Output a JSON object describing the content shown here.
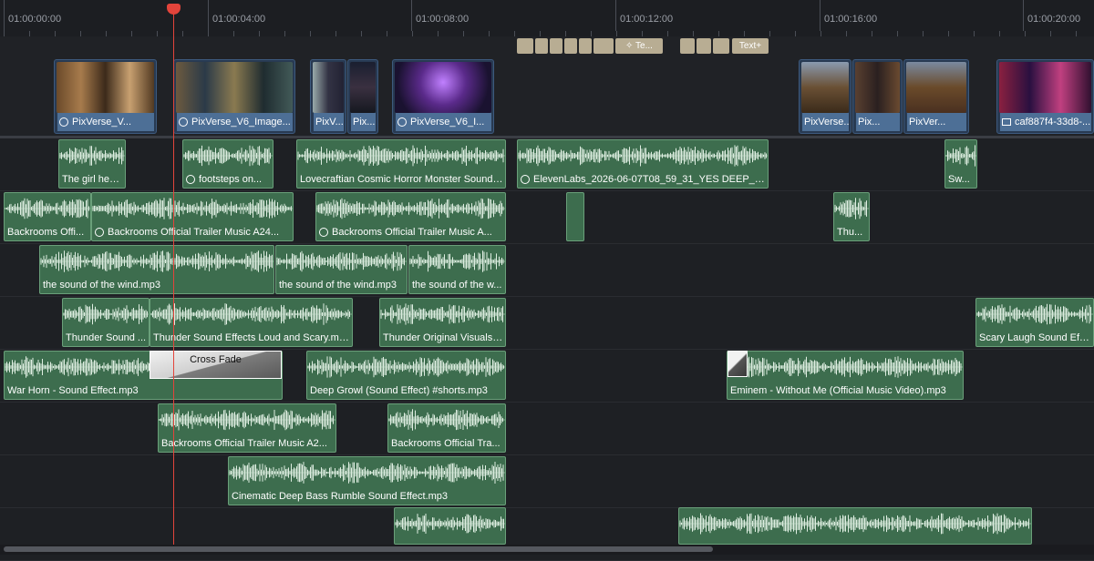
{
  "timeline": {
    "ruler": {
      "timecodes": [
        "01:00:00:00",
        "01:00:04:00",
        "01:00:08:00",
        "01:00:12:00",
        "01:00:16:00",
        "01:00:20:00"
      ]
    },
    "title_track": {
      "text_clip_1": "Te...",
      "text_clip_2": "Text+"
    },
    "video_track": {
      "clips": [
        {
          "label": "PixVerse_V...",
          "speed_icon": true
        },
        {
          "label": "PixVerse_V6_Image...",
          "speed_icon": true
        },
        {
          "label": "PixV...",
          "speed_icon": false
        },
        {
          "label": "Pix...",
          "speed_icon": false
        },
        {
          "label": "PixVerse_V6_I...",
          "speed_icon": true
        },
        {
          "label": "PixVerse...",
          "speed_icon": false
        },
        {
          "label": "Pix...",
          "speed_icon": false
        },
        {
          "label": "PixVer...",
          "speed_icon": false
        },
        {
          "label": "caf887f4-33d8-...",
          "speed_icon": false
        }
      ]
    },
    "audio_tracks": [
      {
        "clips": [
          {
            "label": "The girl hea...",
            "speed_icon": false
          },
          {
            "label": "footsteps on...",
            "speed_icon": true
          },
          {
            "label": "Lovecraftian Cosmic Horror Monster Sound ...",
            "speed_icon": false
          },
          {
            "label": "ElevenLabs_2026-06-07T08_59_31_YES DEEP_gen...",
            "speed_icon": true
          },
          {
            "label": "Sw...",
            "speed_icon": false
          }
        ]
      },
      {
        "clips": [
          {
            "label": "Backrooms  Offi...",
            "speed_icon": false
          },
          {
            "label": "Backrooms  Official Trailer Music  A24...",
            "speed_icon": true
          },
          {
            "label": "Backrooms  Official Trailer Music  A...",
            "speed_icon": true
          },
          {
            "label": "",
            "speed_icon": false
          },
          {
            "label": "Thu...",
            "speed_icon": false
          }
        ]
      },
      {
        "clips": [
          {
            "label": "the sound of the wind.mp3",
            "speed_icon": false
          },
          {
            "label": "the sound of the wind.mp3",
            "speed_icon": false
          },
          {
            "label": "the sound of the w...",
            "speed_icon": false
          }
        ]
      },
      {
        "clips": [
          {
            "label": "Thunder Sound ...",
            "speed_icon": false
          },
          {
            "label": "Thunder Sound Effects Loud and Scary.mp3",
            "speed_icon": false
          },
          {
            "label": "Thunder Original Visuals ...",
            "speed_icon": false
          },
          {
            "label": "Scary Laugh Sound Effe...",
            "speed_icon": false
          }
        ]
      },
      {
        "clips": [
          {
            "label": "War Horn - Sound Effect.mp3",
            "speed_icon": false
          },
          {
            "label": "Deep Growl (Sound Effect) #shorts.mp3",
            "speed_icon": false
          },
          {
            "label": "Eminem - Without Me (Official Music Video).mp3",
            "speed_icon": false
          }
        ]
      },
      {
        "clips": [
          {
            "label": "Backrooms  Official Trailer Music  A2...",
            "speed_icon": false
          },
          {
            "label": "Backrooms  Official Tra...",
            "speed_icon": false
          }
        ]
      },
      {
        "clips": [
          {
            "label": "Cinematic Deep Bass Rumble Sound Effect.mp3",
            "speed_icon": false
          }
        ]
      },
      {
        "clips": [
          {
            "label": "",
            "speed_icon": false
          },
          {
            "label": "",
            "speed_icon": false
          }
        ]
      }
    ],
    "transition": {
      "label": "Cross Fade"
    },
    "colors": {
      "background": "#1f2126",
      "audio_clip": "#3d6d4e",
      "video_label": "#4d6f96",
      "title_clip": "#b8ad93",
      "playhead": "#e3443b"
    }
  }
}
